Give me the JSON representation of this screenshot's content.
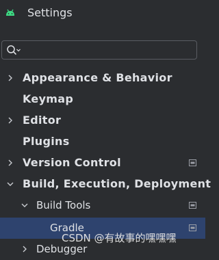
{
  "window": {
    "title": "Settings"
  },
  "search": {
    "value": "",
    "placeholder": ""
  },
  "tree": {
    "items": [
      {
        "label": "Appearance & Behavior",
        "expandable": true,
        "expanded": false,
        "level": 0,
        "badge": false,
        "selected": false
      },
      {
        "label": "Keymap",
        "expandable": false,
        "expanded": false,
        "level": 0,
        "badge": false,
        "selected": false
      },
      {
        "label": "Editor",
        "expandable": true,
        "expanded": false,
        "level": 0,
        "badge": false,
        "selected": false
      },
      {
        "label": "Plugins",
        "expandable": false,
        "expanded": false,
        "level": 0,
        "badge": false,
        "selected": false
      },
      {
        "label": "Version Control",
        "expandable": true,
        "expanded": false,
        "level": 0,
        "badge": true,
        "selected": false
      },
      {
        "label": "Build, Execution, Deployment",
        "expandable": true,
        "expanded": true,
        "level": 0,
        "badge": false,
        "selected": false
      },
      {
        "label": "Build Tools",
        "expandable": true,
        "expanded": true,
        "level": 1,
        "badge": true,
        "selected": false
      },
      {
        "label": "Gradle",
        "expandable": false,
        "expanded": false,
        "level": 2,
        "badge": true,
        "selected": true
      },
      {
        "label": "Debugger",
        "expandable": true,
        "expanded": false,
        "level": 1,
        "badge": false,
        "selected": false
      }
    ]
  },
  "watermark": {
    "text": "CSDN @有故事的嘿嘿嘿"
  },
  "colors": {
    "background": "#2b2d30",
    "selection": "#2e436e",
    "android_green": "#3ddc84",
    "text": "#dfe1e5"
  },
  "icons": {
    "app": "android-icon",
    "search": "search-icon",
    "collapsed": "chevron-right-icon",
    "expanded": "chevron-down-icon",
    "project_level": "project-settings-icon"
  }
}
